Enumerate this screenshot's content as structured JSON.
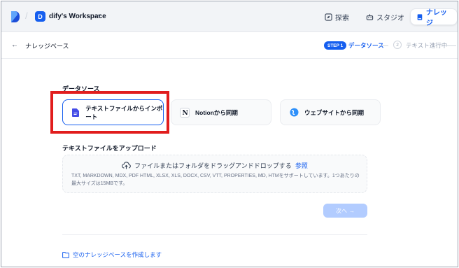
{
  "header": {
    "workspace_initial": "D",
    "workspace_name": "dify's Workspace",
    "nav": {
      "explore": "探索",
      "studio": "スタジオ",
      "knowledge": "ナレッジ"
    }
  },
  "subheader": {
    "title": "ナレッジベース",
    "steps": {
      "step1_badge": "STEP 1",
      "step1_label": "データソース",
      "step2_num": "2",
      "step2_label": "テキスト進行中"
    }
  },
  "data_source": {
    "title": "データソース",
    "options": [
      {
        "label": "テキストファイルからインポート",
        "icon": "file-text-icon",
        "selected": true
      },
      {
        "label": "Notionから同期",
        "icon": "notion-icon",
        "selected": false
      },
      {
        "label": "ウェブサイトから同期",
        "icon": "globe-icon",
        "selected": false
      }
    ]
  },
  "upload": {
    "title": "テキストファイルをアップロード",
    "main_text": "ファイルまたはフォルダをドラッグアンドドロップする",
    "browse_link": "参照",
    "hint": "TXT, MARKDOWN, MDX, PDF HTML, XLSX, XLS, DOCX, CSV, VTT, PROPERTIES, MD, HTMをサポートしています。1つあたりの最大サイズは15MBです。"
  },
  "next_button": "次へ",
  "create_empty_link": "空のナレッジベースを作成します",
  "colors": {
    "accent": "#155eef",
    "highlight": "#e11d1d"
  }
}
